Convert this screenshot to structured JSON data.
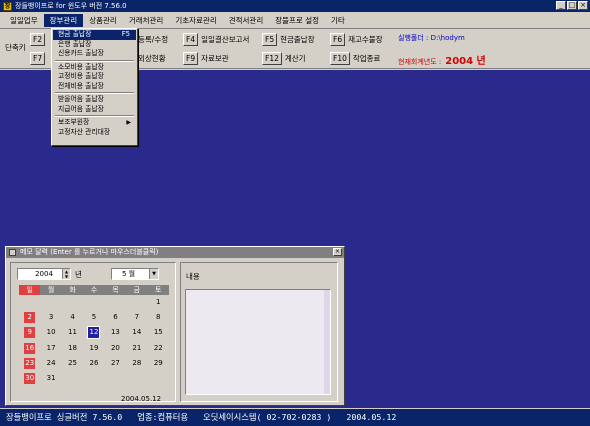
{
  "window": {
    "title": "장들뱅이프로 for 윈도우 버전 7.56.0",
    "icon": "app-icon",
    "controls": [
      "_",
      "□",
      "×"
    ]
  },
  "menubar": {
    "items": [
      "일일업무",
      "장부관리",
      "상품관리",
      "거래처관리",
      "기초자료관리",
      "견적서관리",
      "장뜰프로 설정",
      "기타"
    ],
    "active_index": 1
  },
  "toolbar": {
    "side_label": "단축키",
    "buttons": [
      {
        "key": "F2",
        "label": ""
      },
      {
        "key": "",
        "label": "등록/수정"
      },
      {
        "key": "F4",
        "label": "일일결산보고서"
      },
      {
        "key": "F5",
        "label": "현금출납장"
      },
      {
        "key": "F6",
        "label": "재고수불장"
      },
      {
        "key": "F7",
        "label": ""
      },
      {
        "key": "",
        "label": "외상현황"
      },
      {
        "key": "F9",
        "label": "자료보관"
      },
      {
        "key": "F12",
        "label": "계산기"
      },
      {
        "key": "F10",
        "label": "작업종료"
      }
    ],
    "path_label": "실행폴더 : D:\\hodym",
    "fiscal_label": "현재회계년도 :",
    "fiscal_year": "2004 년"
  },
  "dropdown": {
    "items": [
      {
        "label": "현금 출납장",
        "shortcut": "F5",
        "highlight": true
      },
      {
        "label": "은행 출납장"
      },
      {
        "label": "신용카드 출납장"
      },
      {
        "sep": true
      },
      {
        "label": "소모비용 출납장"
      },
      {
        "label": "고정비용 출납장"
      },
      {
        "label": "전체비용 출납장"
      },
      {
        "sep": true
      },
      {
        "label": "받을어음 출납장"
      },
      {
        "label": "지급어음 출납장"
      },
      {
        "sep": true
      },
      {
        "label": "보조부원장",
        "submenu": true
      },
      {
        "label": "고정자산 관리대장"
      }
    ]
  },
  "memo": {
    "title": "메모 달력 (Enter 를 누르거나 마우스더블클릭)",
    "year": "2004",
    "year_suffix": "년",
    "month": "5 월",
    "weekdays": [
      "일",
      "월",
      "화",
      "수",
      "목",
      "금",
      "토"
    ],
    "days": [
      "",
      "",
      "",
      "",
      "",
      "",
      "1",
      "2",
      "3",
      "4",
      "5",
      "6",
      "7",
      "8",
      "9",
      "10",
      "11",
      "12",
      "13",
      "14",
      "15",
      "16",
      "17",
      "18",
      "19",
      "20",
      "21",
      "22",
      "23",
      "24",
      "25",
      "26",
      "27",
      "28",
      "29",
      "30",
      "31",
      "",
      "",
      "",
      "",
      ""
    ],
    "today": "12",
    "date_text": "2004.05.12",
    "note_label": "내용",
    "note_text": ""
  },
  "statusbar": {
    "text": "장들뱅이프로 싱글버전 7.56.0   업종:컴퓨터용   오딧세이시스템( 02-702-0283 )   2004.05.12"
  },
  "colors": {
    "desktop": "#2a2a8c",
    "titlebar": "#0a246a",
    "sunday": "#e04040",
    "fiscal": "#d00000"
  }
}
